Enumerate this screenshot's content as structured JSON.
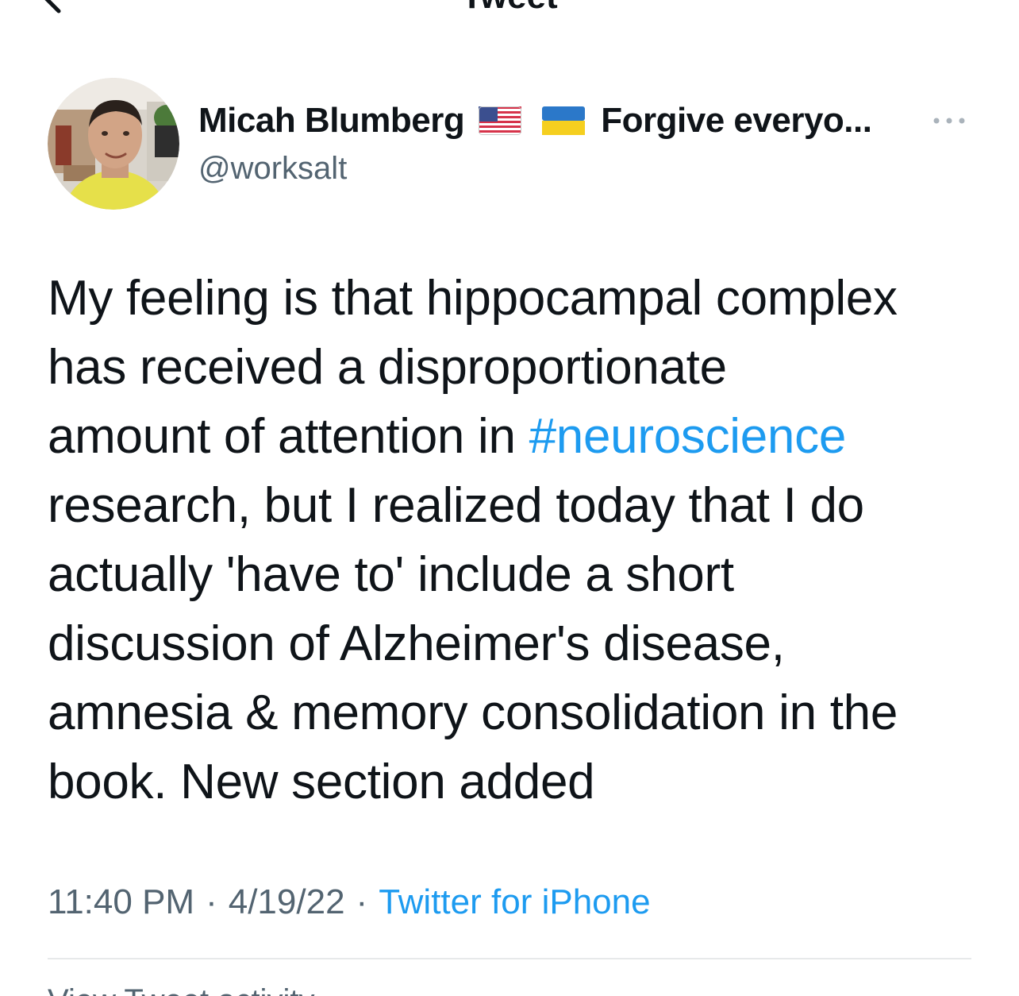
{
  "header": {
    "title": "Tweet",
    "back_icon": "chevron-left-icon"
  },
  "author": {
    "name": "Micah Blumberg",
    "name_suffix": "Forgive everyo...",
    "handle": "@worksalt",
    "flags": [
      "us-flag-icon",
      "ukraine-flag-icon"
    ],
    "more_icon": "ellipsis-icon"
  },
  "tweet": {
    "lines": [
      "My feeling is that hippocampal complex",
      "has received a disproportionate",
      "amount of attention in ",
      "research, but I realized today that I do",
      "actually 'have to' include a short",
      "discussion of Alzheimer's disease,",
      "amnesia & memory consolidation in the",
      "book. New section added"
    ],
    "hashtag": "#neuroscience"
  },
  "meta": {
    "time": "11:40 PM",
    "date": "4/19/22",
    "separator": "·",
    "source": "Twitter for iPhone"
  },
  "footer": {
    "partial_text": "View Tweet activity"
  },
  "colors": {
    "link": "#1d9bf0",
    "text": "#0f1419",
    "secondary": "#536471",
    "divider": "#e7e9ea"
  }
}
